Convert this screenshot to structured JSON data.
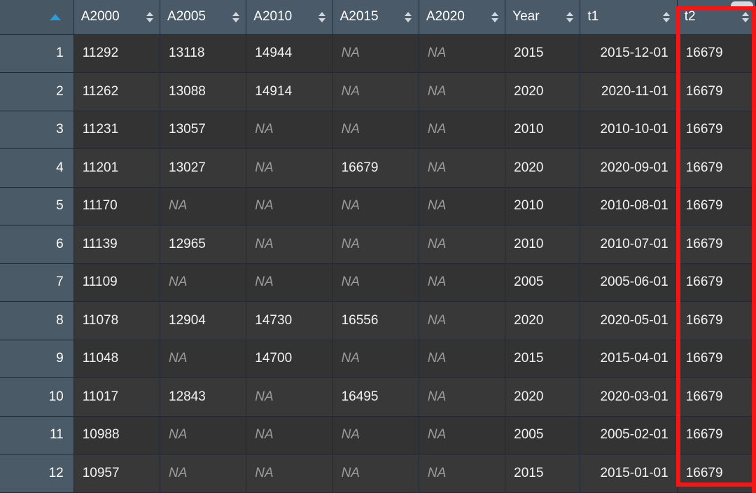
{
  "grid": {
    "row_header_sort_indicator": "sort-ascending-arrow",
    "sort_icon_name": "sort-updown-icon",
    "highlight_color": "#f41616",
    "highlighted_column": "t2",
    "columns": [
      {
        "key": "rownum",
        "label": ""
      },
      {
        "key": "A2000",
        "label": "A2000"
      },
      {
        "key": "A2005",
        "label": "A2005"
      },
      {
        "key": "A2010",
        "label": "A2010"
      },
      {
        "key": "A2015",
        "label": "A2015"
      },
      {
        "key": "A2020",
        "label": "A2020"
      },
      {
        "key": "Year",
        "label": "Year"
      },
      {
        "key": "t1",
        "label": "t1"
      },
      {
        "key": "t2",
        "label": "t2"
      }
    ],
    "na_text": "NA",
    "rows": [
      {
        "n": "1",
        "A2000": "11292",
        "A2005": "13118",
        "A2010": "14944",
        "A2015": "NA",
        "A2020": "NA",
        "Year": "2015",
        "t1": "2015-12-01",
        "t2": "16679"
      },
      {
        "n": "2",
        "A2000": "11262",
        "A2005": "13088",
        "A2010": "14914",
        "A2015": "NA",
        "A2020": "NA",
        "Year": "2020",
        "t1": "2020-11-01",
        "t2": "16679"
      },
      {
        "n": "3",
        "A2000": "11231",
        "A2005": "13057",
        "A2010": "NA",
        "A2015": "NA",
        "A2020": "NA",
        "Year": "2010",
        "t1": "2010-10-01",
        "t2": "16679"
      },
      {
        "n": "4",
        "A2000": "11201",
        "A2005": "13027",
        "A2010": "NA",
        "A2015": "16679",
        "A2020": "NA",
        "Year": "2020",
        "t1": "2020-09-01",
        "t2": "16679"
      },
      {
        "n": "5",
        "A2000": "11170",
        "A2005": "NA",
        "A2010": "NA",
        "A2015": "NA",
        "A2020": "NA",
        "Year": "2010",
        "t1": "2010-08-01",
        "t2": "16679"
      },
      {
        "n": "6",
        "A2000": "11139",
        "A2005": "12965",
        "A2010": "NA",
        "A2015": "NA",
        "A2020": "NA",
        "Year": "2010",
        "t1": "2010-07-01",
        "t2": "16679"
      },
      {
        "n": "7",
        "A2000": "11109",
        "A2005": "NA",
        "A2010": "NA",
        "A2015": "NA",
        "A2020": "NA",
        "Year": "2005",
        "t1": "2005-06-01",
        "t2": "16679"
      },
      {
        "n": "8",
        "A2000": "11078",
        "A2005": "12904",
        "A2010": "14730",
        "A2015": "16556",
        "A2020": "NA",
        "Year": "2020",
        "t1": "2020-05-01",
        "t2": "16679"
      },
      {
        "n": "9",
        "A2000": "11048",
        "A2005": "NA",
        "A2010": "14700",
        "A2015": "NA",
        "A2020": "NA",
        "Year": "2015",
        "t1": "2015-04-01",
        "t2": "16679"
      },
      {
        "n": "10",
        "A2000": "11017",
        "A2005": "12843",
        "A2010": "NA",
        "A2015": "16495",
        "A2020": "NA",
        "Year": "2020",
        "t1": "2020-03-01",
        "t2": "16679"
      },
      {
        "n": "11",
        "A2000": "10988",
        "A2005": "NA",
        "A2010": "NA",
        "A2015": "NA",
        "A2020": "NA",
        "Year": "2005",
        "t1": "2005-02-01",
        "t2": "16679"
      },
      {
        "n": "12",
        "A2000": "10957",
        "A2005": "NA",
        "A2010": "NA",
        "A2015": "NA",
        "A2020": "NA",
        "Year": "2015",
        "t1": "2015-01-01",
        "t2": "16679"
      }
    ]
  }
}
